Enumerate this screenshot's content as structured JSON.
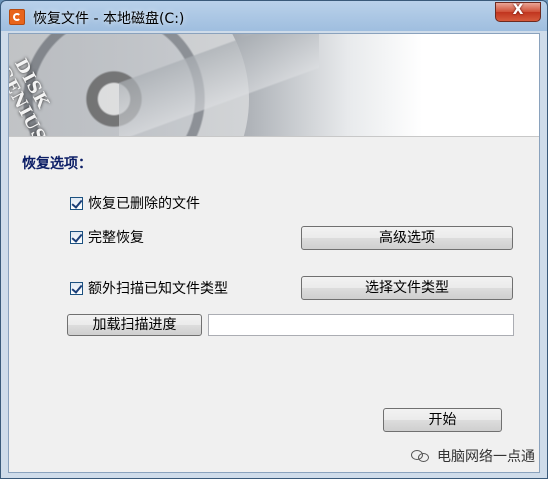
{
  "window": {
    "title": "恢复文件 - 本地磁盘(C:)",
    "close_symbol": "X"
  },
  "banner": {
    "logo_line1": "DISK",
    "logo_line2": "GENIUS"
  },
  "section": {
    "label": "恢复选项："
  },
  "options": [
    {
      "label": "恢复已删除的文件",
      "checked": true
    },
    {
      "label": "完整恢复",
      "checked": true
    },
    {
      "label": "额外扫描已知文件类型",
      "checked": true
    }
  ],
  "buttons": {
    "advanced": "高级选项",
    "select_types": "选择文件类型",
    "load_progress": "加载扫描进度",
    "start": "开始"
  },
  "progress_path": {
    "value": ""
  },
  "watermark": {
    "text": "电脑网络一点通",
    "icon": "wechat-icon"
  },
  "colors": {
    "titlebar": "#b9d1ea",
    "close_button": "#c8432a",
    "section_label": "#0c1e66",
    "client_bg": "#f0f0f0"
  }
}
